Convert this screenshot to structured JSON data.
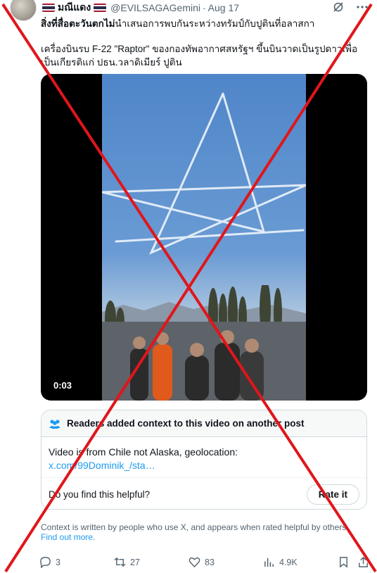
{
  "header": {
    "display_name": "มณีแดง",
    "handle": "@EVILSAGAGemini",
    "separator": "·",
    "date": "Aug 17"
  },
  "post": {
    "line1_bold": "สิ่งที่สื่อตะวันตกไม่",
    "line1_rest": "นำเสนอการพบกันระหว่างทรัมป์กับปูตินที่อลาสกา",
    "body": "เครื่องบินรบ F-22 \"Raptor\" ของกองทัพอากาศสหรัฐฯ ขึ้นบินวาดเป็นรูปดาวเพื่อเป็นเกียรติแก่ ปธน.วลาดิเมียร์ ปูติน"
  },
  "video": {
    "time": "0:03"
  },
  "community_note": {
    "title": "Readers added context to this video on another post",
    "text": "Video is from Chile not Alaska, geolocation:",
    "link": "x.com/99Dominik_/sta…",
    "helpful_question": "Do you find this helpful?",
    "rate_button": "Rate it"
  },
  "context_note": {
    "text": "Context is written by people who use X, and appears when rated helpful by others.",
    "find_out": "Find out more."
  },
  "actions": {
    "replies": "3",
    "reposts": "27",
    "likes": "83",
    "views": "4.9K"
  },
  "colors": {
    "accent": "#1d9bf0",
    "overlay_red": "#e0161b",
    "muted": "#536471"
  },
  "icons": [
    "grok-icon",
    "more-icon",
    "people-icon",
    "reply-icon",
    "repost-icon",
    "like-icon",
    "views-icon",
    "bookmark-icon",
    "share-icon"
  ]
}
